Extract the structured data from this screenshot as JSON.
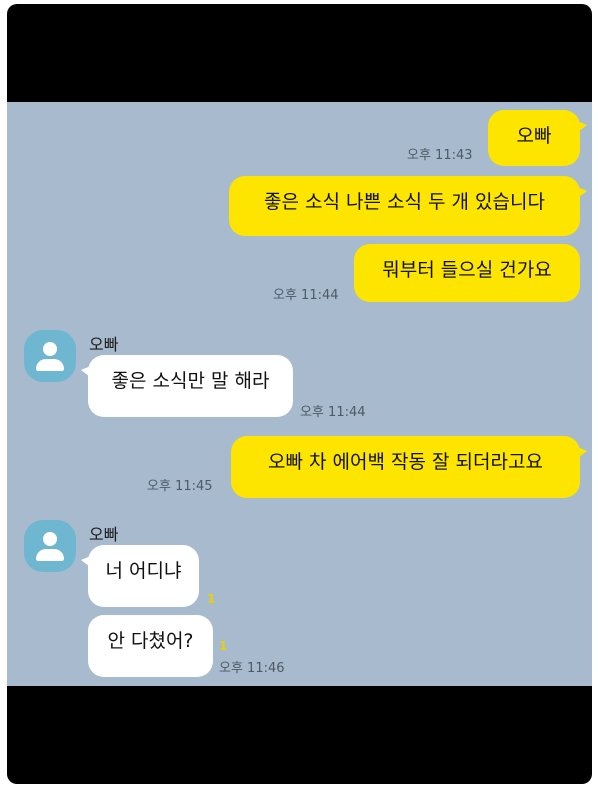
{
  "chat": {
    "background_color": "#a8bace",
    "outgoing_bubble_color": "#fde500",
    "incoming_bubble_color": "#ffffff",
    "avatar_color": "#6fb7d0",
    "messages": [
      {
        "direction": "out",
        "text": "오빠"
      },
      {
        "direction": "out",
        "text": "좋은 소식 나쁜 소식 두 개 있습니다"
      },
      {
        "direction": "out",
        "text": "뭐부터 들으실 건가요"
      },
      {
        "direction": "in",
        "sender": "오빠",
        "text": "좋은 소식만 말 해라"
      },
      {
        "direction": "out",
        "text": "오빠 차 에어백 작동 잘 되더라고요"
      },
      {
        "direction": "in",
        "sender": "오빠",
        "text": "너 어디냐"
      },
      {
        "direction": "in",
        "text": "안 다쳤어?"
      }
    ],
    "times": [
      "오후 11:43",
      "오후 11:44",
      "오후 11:44",
      "오후 11:45",
      "오후 11:46"
    ],
    "unread_marks": [
      "1",
      "1"
    ]
  }
}
